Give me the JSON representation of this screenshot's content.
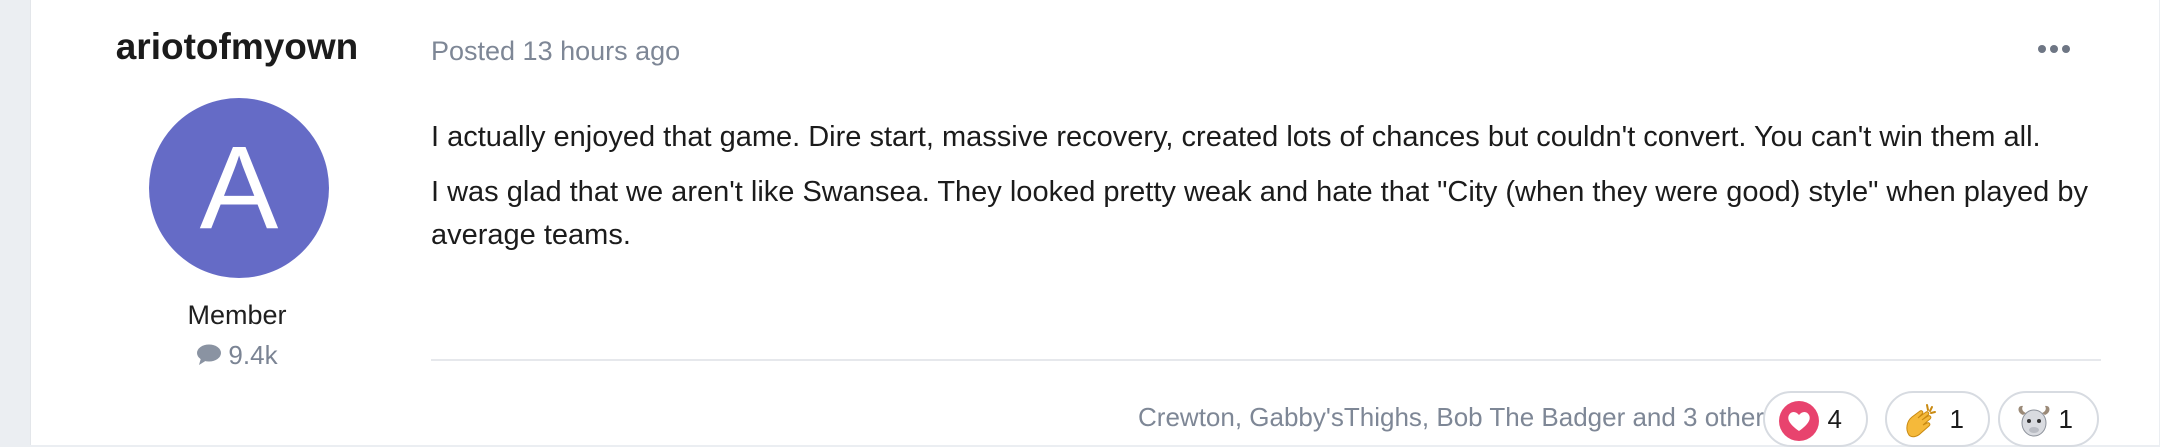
{
  "author": {
    "name": "ariotofmyown",
    "avatar_letter": "A",
    "avatar_color": "#656bc6",
    "member_title": "Member",
    "post_count": "9.4k"
  },
  "post": {
    "posted_label": "Posted 13 hours ago",
    "paragraphs": [
      "I actually enjoyed that game. Dire start, massive recovery, created lots of chances but couldn't convert. You can't win them all.",
      "I was glad that we aren't like Swansea. They looked pretty weak and hate that \"City (when they were good) style\" when played by average teams."
    ]
  },
  "reactions": {
    "reactors_text": "Crewton, Gabby'sThighs, Bob The Badger and 3 others",
    "items": [
      {
        "icon": "heart-icon",
        "count": "4"
      },
      {
        "icon": "clapping-hands-icon",
        "count": "1"
      },
      {
        "icon": "goat-icon",
        "count": "1"
      }
    ]
  },
  "colors": {
    "page_bg": "#ebeef2",
    "muted_text": "#7e8796",
    "heart": "#e8436e"
  }
}
